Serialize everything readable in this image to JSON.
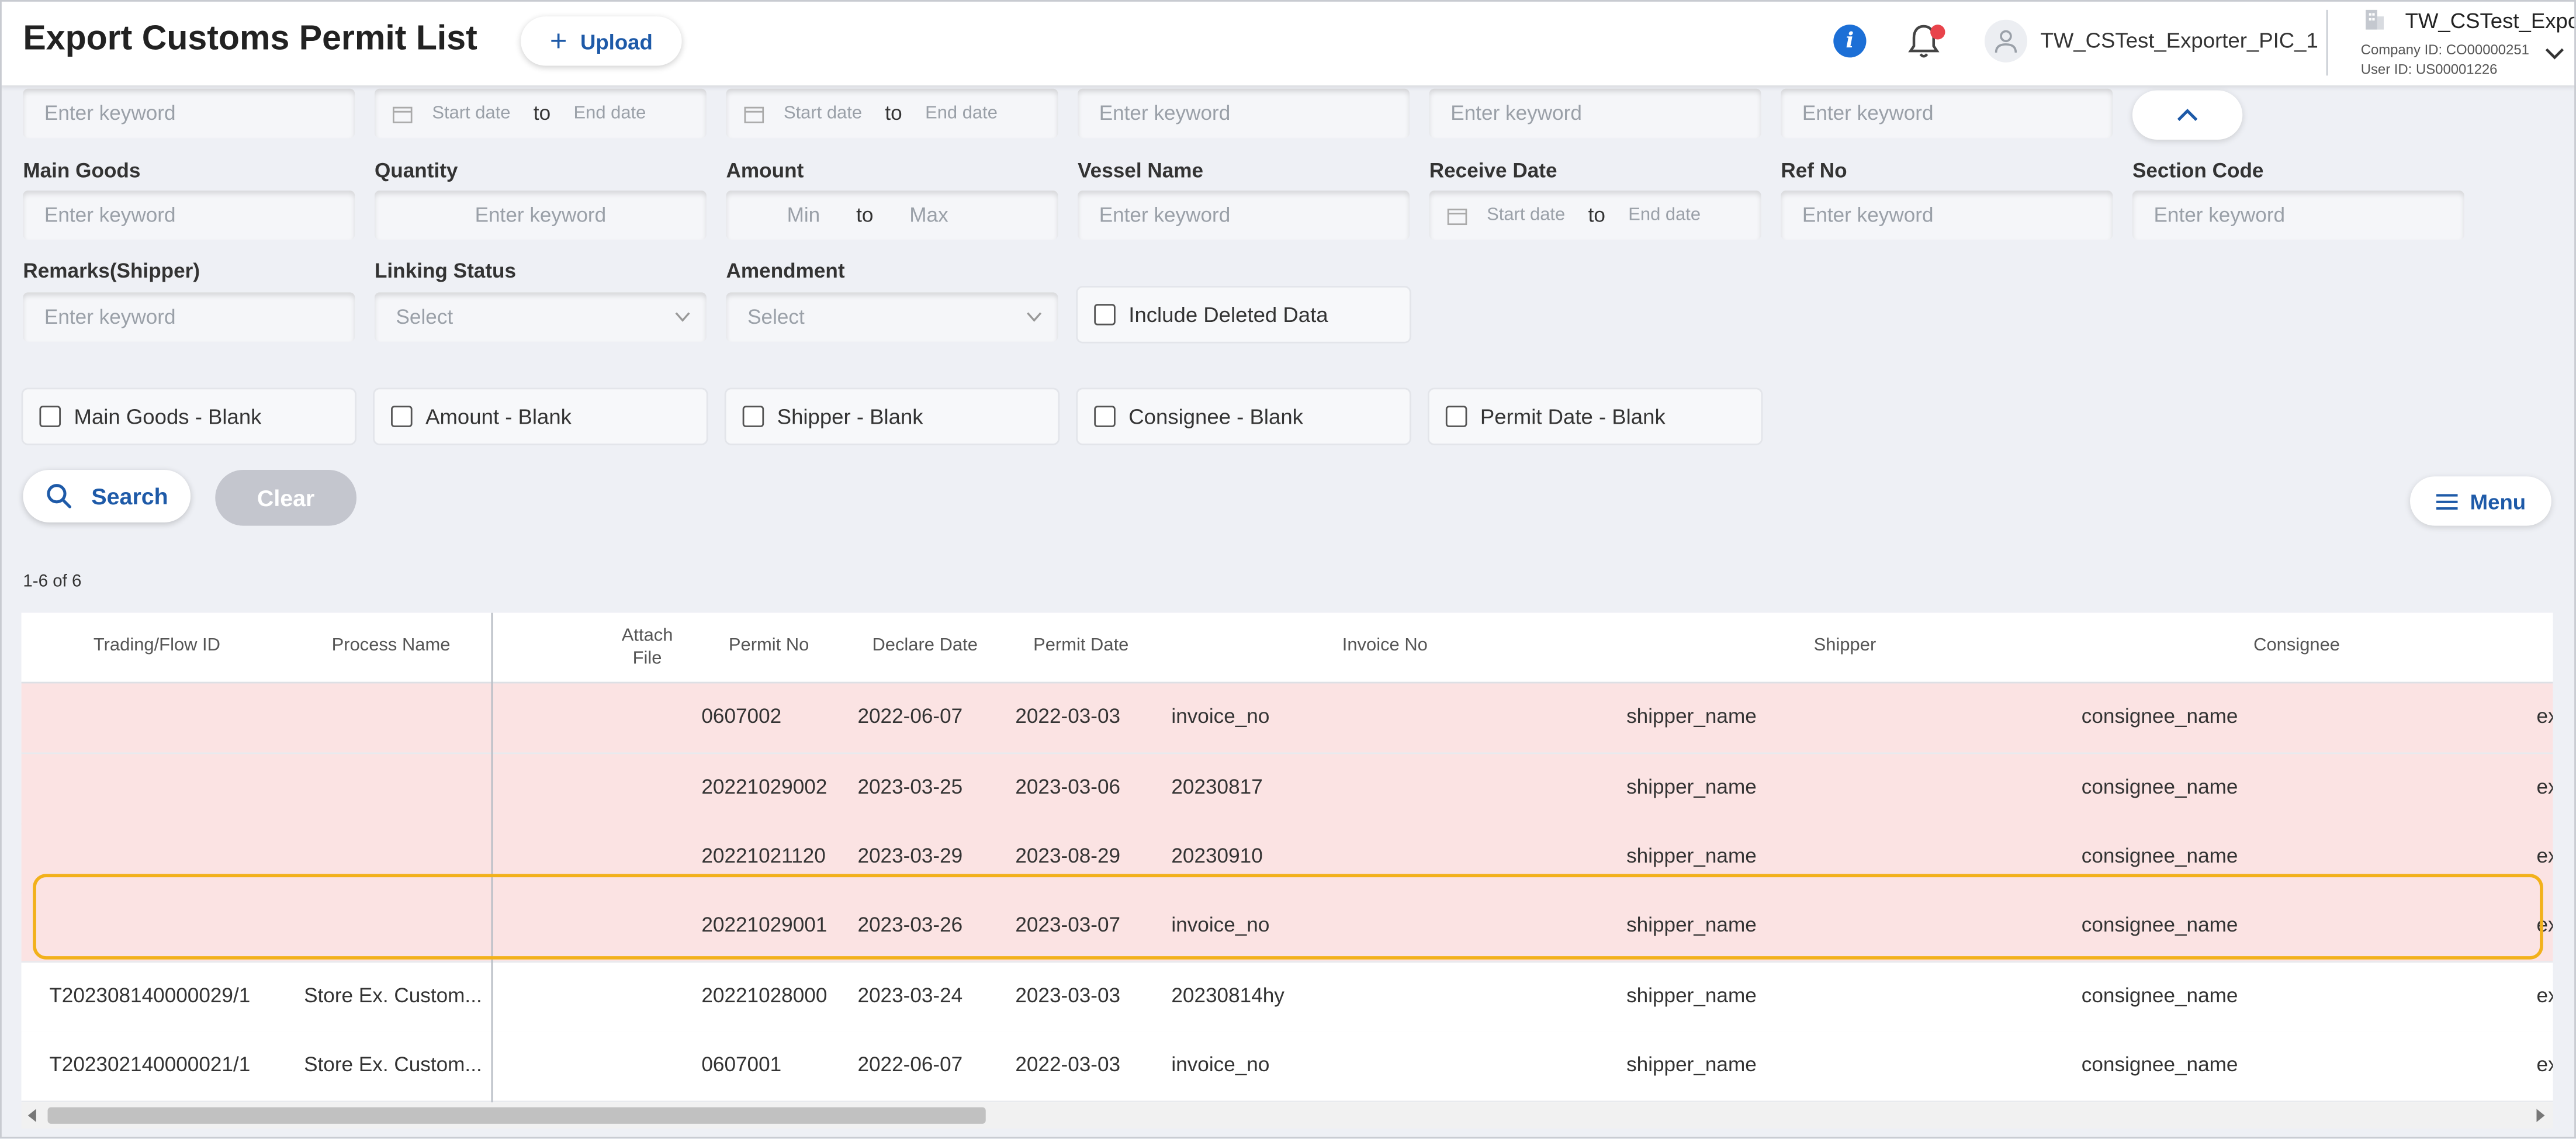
{
  "header": {
    "title": "Export Customs Permit List",
    "upload_label": "Upload",
    "user_name": "TW_CSTest_Exporter_PIC_1",
    "company_name": "TW_CSTest_Expo...",
    "company_id": "Company ID: CO00000251",
    "user_id": "User ID: US00001226"
  },
  "filters": {
    "row0": {
      "kw1": "Enter keyword",
      "date1_start": "Start date",
      "date1_to": "to",
      "date1_end": "End date",
      "date2_start": "Start date",
      "date2_to": "to",
      "date2_end": "End date",
      "kw4": "Enter keyword",
      "kw5": "Enter keyword",
      "kw6": "Enter keyword"
    },
    "row1": {
      "main_goods_label": "Main Goods",
      "main_goods_ph": "Enter keyword",
      "quantity_label": "Quantity",
      "quantity_ph": "Enter keyword",
      "amount_label": "Amount",
      "amount_min": "Min",
      "amount_to": "to",
      "amount_max": "Max",
      "vessel_label": "Vessel Name",
      "vessel_ph": "Enter keyword",
      "receive_label": "Receive Date",
      "receive_start": "Start date",
      "receive_to": "to",
      "receive_end": "End date",
      "ref_label": "Ref No",
      "ref_ph": "Enter keyword",
      "section_label": "Section Code",
      "section_ph": "Enter keyword"
    },
    "row2": {
      "remarks_label": "Remarks(Shipper)",
      "remarks_ph": "Enter keyword",
      "linking_label": "Linking Status",
      "linking_value": "Select",
      "amendment_label": "Amendment",
      "amendment_value": "Select",
      "include_deleted": "Include Deleted Data"
    },
    "blank_checks": [
      "Main Goods - Blank",
      "Amount - Blank",
      "Shipper - Blank",
      "Consignee - Blank",
      "Permit Date - Blank"
    ]
  },
  "actions": {
    "search": "Search",
    "clear": "Clear",
    "menu": "Menu",
    "result_count": "1-6 of 6"
  },
  "table": {
    "columns": [
      "Trading/Flow ID",
      "Process Name",
      "Attach File",
      "Permit No",
      "Declare Date",
      "Permit Date",
      "Invoice No",
      "Shipper",
      "Consignee"
    ],
    "rows": [
      {
        "flow_id": "",
        "process": "",
        "permit_no": "0607002",
        "declare": "2022-06-07",
        "permit_date": "2022-03-03",
        "invoice": "invoice_no",
        "shipper": "shipper_name",
        "consignee": "consignee_name",
        "extra": "ex",
        "deleted": true
      },
      {
        "flow_id": "",
        "process": "",
        "permit_no": "20221029002",
        "declare": "2023-03-25",
        "permit_date": "2023-03-06",
        "invoice": "20230817",
        "shipper": "shipper_name",
        "consignee": "consignee_name",
        "extra": "ex",
        "deleted": true
      },
      {
        "flow_id": "",
        "process": "",
        "permit_no": "20221021120",
        "declare": "2023-03-29",
        "permit_date": "2023-08-29",
        "invoice": "20230910",
        "shipper": "shipper_name",
        "consignee": "consignee_name",
        "extra": "ex",
        "deleted": true
      },
      {
        "flow_id": "",
        "process": "",
        "permit_no": "20221029001",
        "declare": "2023-03-26",
        "permit_date": "2023-03-07",
        "invoice": "invoice_no",
        "shipper": "shipper_name",
        "consignee": "consignee_name",
        "extra": "ex",
        "deleted": true
      },
      {
        "flow_id": "T202308140000029/1",
        "process": "Store Ex. Custom...",
        "permit_no": "20221028000",
        "declare": "2023-03-24",
        "permit_date": "2023-03-03",
        "invoice": "20230814hy",
        "shipper": "shipper_name",
        "consignee": "consignee_name",
        "extra": "ex",
        "deleted": false
      },
      {
        "flow_id": "T202302140000021/1",
        "process": "Store Ex. Custom...",
        "permit_no": "0607001",
        "declare": "2022-06-07",
        "permit_date": "2022-03-03",
        "invoice": "invoice_no",
        "shipper": "shipper_name",
        "consignee": "consignee_name",
        "extra": "ex",
        "deleted": false
      }
    ]
  },
  "colors": {
    "accent": "#1e5aa8",
    "deleted_row": "#fbe3e3",
    "highlight": "#f2b11b",
    "notification": "#e8434b"
  },
  "icons": [
    "plus-icon",
    "info-icon",
    "bell-icon",
    "user-icon",
    "building-icon",
    "chevron-down-icon",
    "calendar-icon",
    "chevron-up-icon",
    "search-icon",
    "menu-icon"
  ]
}
